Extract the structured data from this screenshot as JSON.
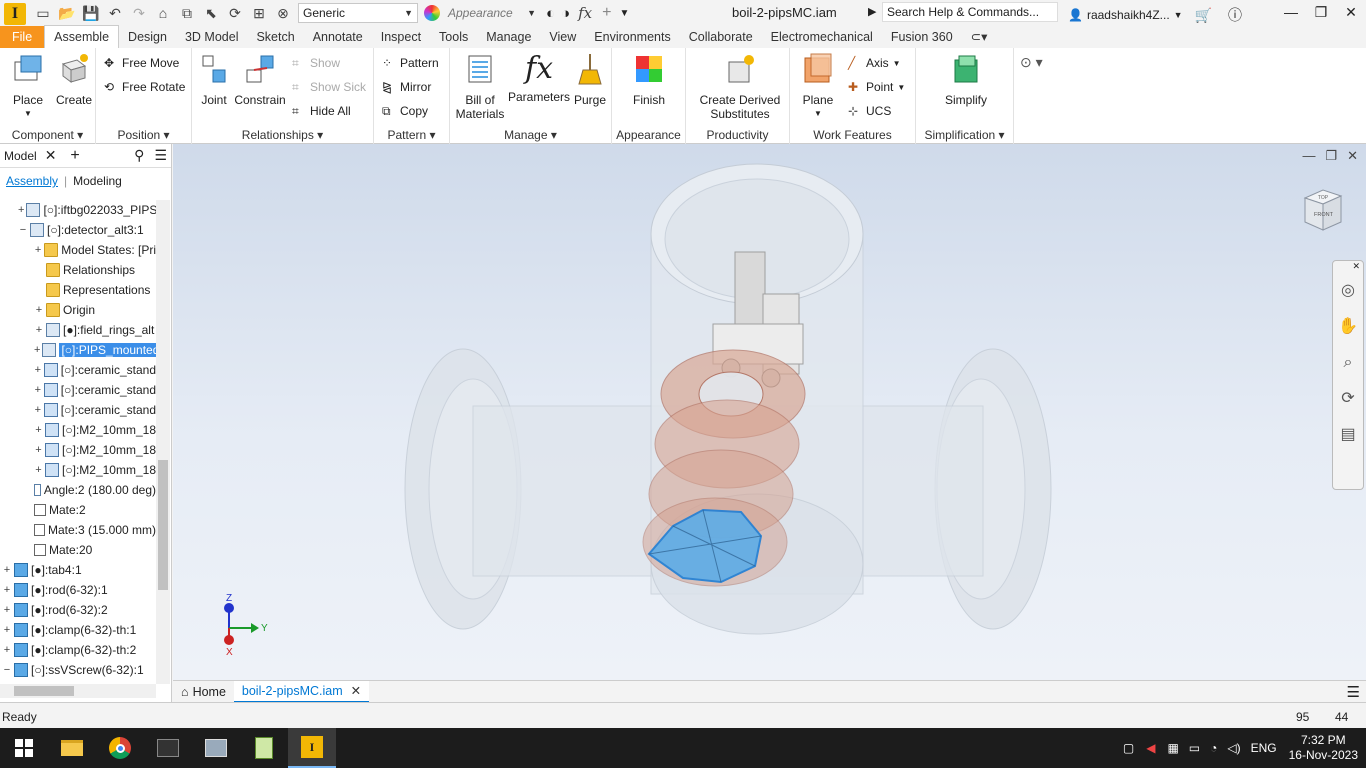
{
  "titlebar": {
    "logo": "I",
    "material": "Generic",
    "appearance_placeholder": "Appearance",
    "fx": "fx",
    "doc_title": "boil-2-pipsMC.iam",
    "search": "Search Help & Commands...",
    "user": "raadshaikh4Z..."
  },
  "menu": {
    "tabs": [
      "File",
      "Assemble",
      "Design",
      "3D Model",
      "Sketch",
      "Annotate",
      "Inspect",
      "Tools",
      "Manage",
      "View",
      "Environments",
      "Collaborate",
      "Electromechanical",
      "Fusion 360"
    ]
  },
  "ribbon": {
    "component": {
      "title": "Component",
      "place": "Place",
      "create": "Create"
    },
    "position": {
      "title": "Position",
      "free_move": "Free Move",
      "free_rotate": "Free Rotate"
    },
    "relationships": {
      "title": "Relationships",
      "joint": "Joint",
      "constrain": "Constrain",
      "show": "Show",
      "show_sick": "Show Sick",
      "hide_all": "Hide All"
    },
    "pattern": {
      "title": "Pattern",
      "pattern": "Pattern",
      "mirror": "Mirror",
      "copy": "Copy"
    },
    "manage": {
      "title": "Manage",
      "bom_1": "Bill of",
      "bom_2": "Materials",
      "parameters": "Parameters",
      "purge": "Purge"
    },
    "appearance": {
      "title": "Appearance",
      "finish": "Finish"
    },
    "productivity": {
      "title": "Productivity",
      "derived_1": "Create Derived",
      "derived_2": "Substitutes"
    },
    "work_features": {
      "title": "Work Features",
      "plane": "Plane",
      "axis": "Axis",
      "point": "Point",
      "ucs": "UCS"
    },
    "simplification": {
      "title": "Simplification",
      "simplify": "Simplify"
    }
  },
  "browser": {
    "tab": "Model",
    "sub_assembly": "Assembly",
    "sub_modeling": "Modeling",
    "items": [
      {
        "label": "[○]:iftbg022033_PIPS"
      },
      {
        "label": "[○]:detector_alt3:1"
      },
      {
        "label": "Model States: [Pri"
      },
      {
        "label": "Relationships"
      },
      {
        "label": "Representations"
      },
      {
        "label": "Origin"
      },
      {
        "label": "[●]:field_rings_alt"
      },
      {
        "label": "[○]:PIPS_mounted"
      },
      {
        "label": "[○]:ceramic_stand"
      },
      {
        "label": "[○]:ceramic_stand"
      },
      {
        "label": "[○]:ceramic_stand"
      },
      {
        "label": "[○]:M2_10mm_18"
      },
      {
        "label": "[○]:M2_10mm_18"
      },
      {
        "label": "[○]:M2_10mm_18"
      },
      {
        "label": "Angle:2 (180.00 deg)"
      },
      {
        "label": "Mate:2"
      },
      {
        "label": "Mate:3 (15.000 mm)"
      },
      {
        "label": "Mate:20"
      },
      {
        "label": "[●]:tab4:1"
      },
      {
        "label": "[●]:rod(6-32):1"
      },
      {
        "label": "[●]:rod(6-32):2"
      },
      {
        "label": "[●]:clamp(6-32)-th:1"
      },
      {
        "label": "[●]:clamp(6-32)-th:2"
      },
      {
        "label": "[○]:ssVScrew(6-32):1"
      }
    ]
  },
  "viewport": {
    "viewcube_top": "TOP",
    "viewcube_front": "FRONT",
    "axis_z": "Z",
    "axis_y": "Y",
    "axis_x": "X"
  },
  "doctabs": {
    "home": "Home",
    "doc": "boil-2-pipsMC.iam"
  },
  "status": {
    "text": "Ready",
    "num1": "95",
    "num2": "44"
  },
  "taskbar": {
    "lang": "ENG",
    "time": "7:32 PM",
    "date": "16-Nov-2023"
  }
}
